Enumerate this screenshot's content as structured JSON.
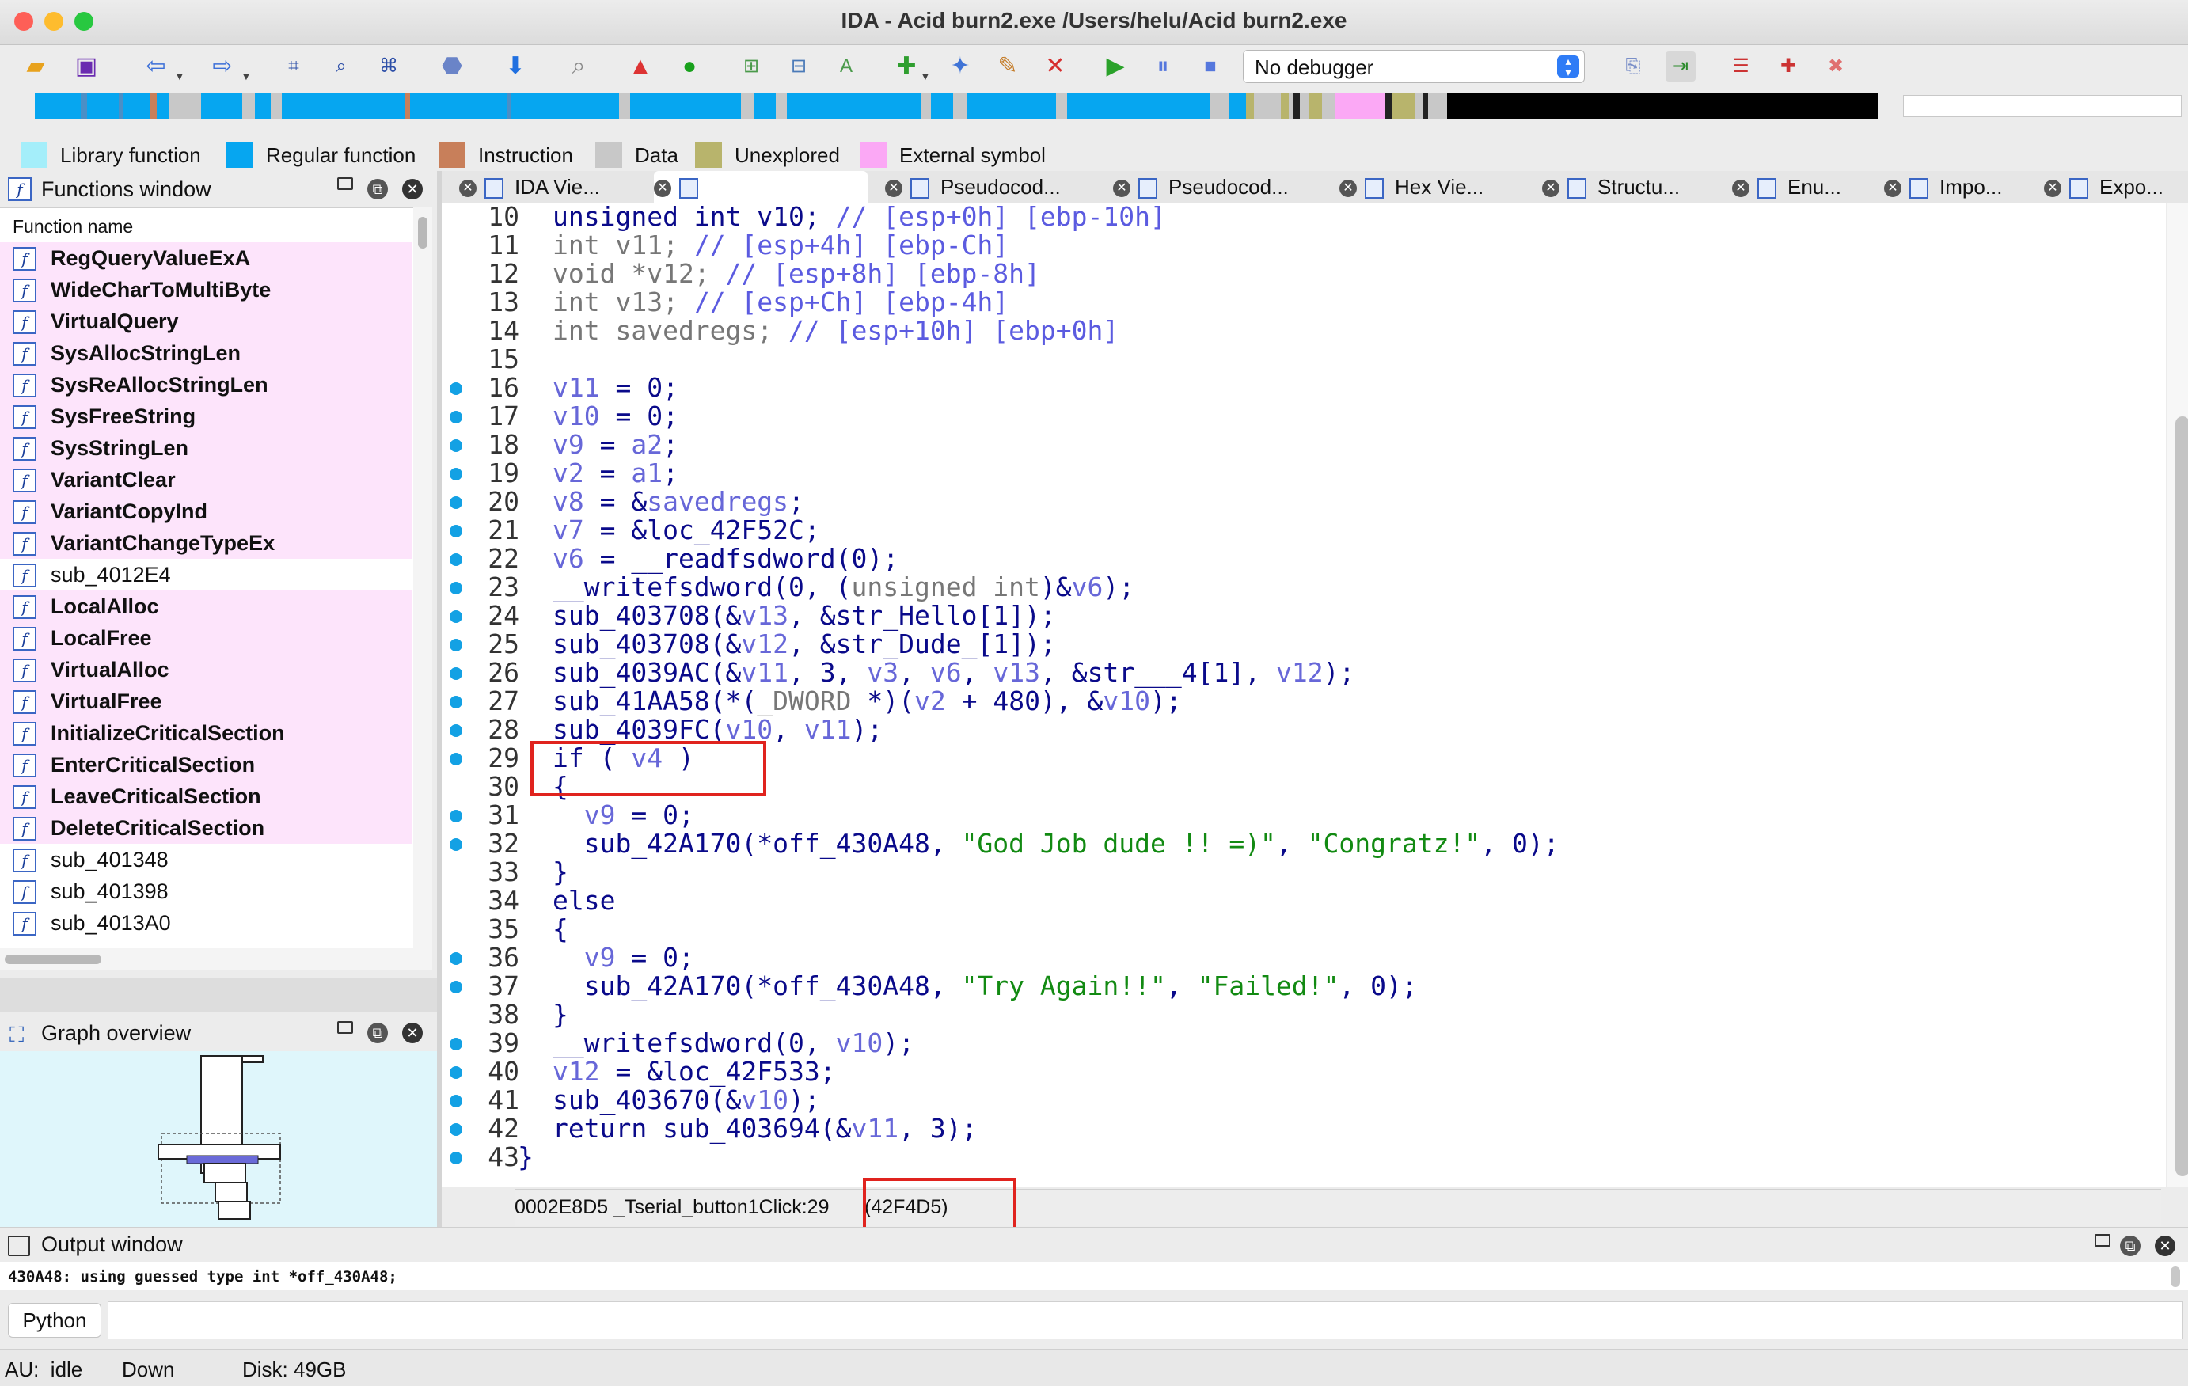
{
  "window": {
    "title": "IDA - Acid burn2.exe /Users/helu/Acid burn2.exe"
  },
  "toolbar": {
    "debugger_select": "No debugger",
    "icons": [
      "open-icon",
      "save-icon",
      "back-icon",
      "forward-icon",
      "jump-icon",
      "search-text-icon",
      "search-binary-icon",
      "hex-icon",
      "down-arrow-icon",
      "search-icon",
      "warning-icon",
      "run-green-icon",
      "code-icon",
      "data-icon",
      "string-icon",
      "add-struct-icon",
      "add-enum-icon",
      "patch-icon",
      "delete-icon",
      "start-debug-icon",
      "pause-icon",
      "stop-icon"
    ]
  },
  "legend": [
    {
      "label": "Library function",
      "color": "#a4eefa"
    },
    {
      "label": "Regular function",
      "color": "#06a6f0"
    },
    {
      "label": "Instruction",
      "color": "#c87f5a"
    },
    {
      "label": "Data",
      "color": "#c8c8c8"
    },
    {
      "label": "Unexplored",
      "color": "#b8b46c"
    },
    {
      "label": "External symbol",
      "color": "#fba8f5"
    }
  ],
  "functions_window": {
    "title": "Functions window",
    "column_header": "Function name",
    "items": [
      {
        "name": "RegQueryValueExA",
        "external": true
      },
      {
        "name": "WideCharToMultiByte",
        "external": true
      },
      {
        "name": "VirtualQuery",
        "external": true
      },
      {
        "name": "SysAllocStringLen",
        "external": true
      },
      {
        "name": "SysReAllocStringLen",
        "external": true
      },
      {
        "name": "SysFreeString",
        "external": true
      },
      {
        "name": "SysStringLen",
        "external": true
      },
      {
        "name": "VariantClear",
        "external": true
      },
      {
        "name": "VariantCopyInd",
        "external": true
      },
      {
        "name": "VariantChangeTypeEx",
        "external": true
      },
      {
        "name": "sub_4012E4",
        "external": false
      },
      {
        "name": "LocalAlloc",
        "external": true
      },
      {
        "name": "LocalFree",
        "external": true
      },
      {
        "name": "VirtualAlloc",
        "external": true
      },
      {
        "name": "VirtualFree",
        "external": true
      },
      {
        "name": "InitializeCriticalSection",
        "external": true
      },
      {
        "name": "EnterCriticalSection",
        "external": true
      },
      {
        "name": "LeaveCriticalSection",
        "external": true
      },
      {
        "name": "DeleteCriticalSection",
        "external": true
      },
      {
        "name": "sub_401348",
        "external": false
      },
      {
        "name": "sub_401398",
        "external": false
      },
      {
        "name": "sub_4013A0",
        "external": false
      }
    ]
  },
  "graph_overview": {
    "title": "Graph overview"
  },
  "tabs": [
    {
      "label": "IDA Vie..."
    },
    {
      "label": ""
    },
    {
      "label": "Pseudocod..."
    },
    {
      "label": "Pseudocod..."
    },
    {
      "label": "Hex Vie..."
    },
    {
      "label": "Structu..."
    },
    {
      "label": "Enu..."
    },
    {
      "label": "Impo..."
    },
    {
      "label": "Expo..."
    }
  ],
  "code_lines": [
    {
      "no": "10",
      "bp": false,
      "html": "unsigned int v10; <span class='c'>// [esp+0h] [ebp-10h]</span>"
    },
    {
      "no": "11",
      "bp": false,
      "html": "<span class='g'>int v11; </span><span class='c'>// [esp+4h] [ebp-Ch]</span>"
    },
    {
      "no": "12",
      "bp": false,
      "html": "<span class='g'>void *v12; </span><span class='c'>// [esp+8h] [ebp-8h]</span>"
    },
    {
      "no": "13",
      "bp": false,
      "html": "<span class='g'>int v13; </span><span class='c'>// [esp+Ch] [ebp-4h]</span>"
    },
    {
      "no": "14",
      "bp": false,
      "html": "<span class='g'>int savedregs; </span><span class='c'>// [esp+10h] [ebp+0h]</span>"
    },
    {
      "no": "15",
      "bp": false,
      "html": ""
    },
    {
      "no": "16",
      "bp": true,
      "html": "<span class='v'>v11</span> = 0;"
    },
    {
      "no": "17",
      "bp": true,
      "html": "<span class='v'>v10</span> = 0;"
    },
    {
      "no": "18",
      "bp": true,
      "html": "<span class='v'>v9</span> = <span class='v'>a2</span>;"
    },
    {
      "no": "19",
      "bp": true,
      "html": "<span class='v'>v2</span> = <span class='v'>a1</span>;"
    },
    {
      "no": "20",
      "bp": true,
      "html": "<span class='v'>v8</span> = &amp;<span class='v'>savedregs</span>;"
    },
    {
      "no": "21",
      "bp": true,
      "html": "<span class='v'>v7</span> = &amp;loc_42F52C;"
    },
    {
      "no": "22",
      "bp": true,
      "html": "<span class='v'>v6</span> = __readfsdword(0);"
    },
    {
      "no": "23",
      "bp": true,
      "html": "__writefsdword(0, (<span class='g'>unsigned int</span>)&amp;<span class='v'>v6</span>);"
    },
    {
      "no": "24",
      "bp": true,
      "html": "sub_403708(&amp;<span class='v'>v13</span>, &amp;str_Hello[1]);"
    },
    {
      "no": "25",
      "bp": true,
      "html": "sub_403708(&amp;<span class='v'>v12</span>, &amp;str_Dude_[1]);"
    },
    {
      "no": "26",
      "bp": true,
      "html": "sub_4039AC(&amp;<span class='v'>v11</span>, 3, <span class='v'>v3</span>, <span class='v'>v6</span>, <span class='v'>v13</span>, &amp;str___4[1], <span class='v'>v12</span>);"
    },
    {
      "no": "27",
      "bp": true,
      "html": "sub_41AA58(*(<span class='g'>_DWORD</span> *)(<span class='v'>v2</span> + 480), &amp;<span class='v'>v10</span>);"
    },
    {
      "no": "28",
      "bp": true,
      "html": "sub_4039FC(<span class='v'>v10</span>, <span class='v'>v11</span>);"
    },
    {
      "no": "29",
      "bp": true,
      "html": "if ( <span class='v'>v4</span> )"
    },
    {
      "no": "30",
      "bp": false,
      "html": "{"
    },
    {
      "no": "31",
      "bp": true,
      "html": "  <span class='v'>v9</span> = 0;"
    },
    {
      "no": "32",
      "bp": true,
      "html": "  sub_42A170(*off_430A48, <span class='s'>\"God Job dude !! =)\"</span>, <span class='s'>\"Congratz!\"</span>, 0);"
    },
    {
      "no": "33",
      "bp": false,
      "html": "}"
    },
    {
      "no": "34",
      "bp": false,
      "html": "else"
    },
    {
      "no": "35",
      "bp": false,
      "html": "{"
    },
    {
      "no": "36",
      "bp": true,
      "html": "  <span class='v'>v9</span> = 0;"
    },
    {
      "no": "37",
      "bp": true,
      "html": "  sub_42A170(*off_430A48, <span class='s'>\"Try Again!!\"</span>, <span class='s'>\"Failed!\"</span>, 0);"
    },
    {
      "no": "38",
      "bp": false,
      "html": "}"
    },
    {
      "no": "39",
      "bp": true,
      "html": "__writefsdword(0, <span class='v'>v10</span>);"
    },
    {
      "no": "40",
      "bp": true,
      "html": "<span class='v'>v12</span> = &amp;loc_42F533;"
    },
    {
      "no": "41",
      "bp": true,
      "html": "sub_403670(&amp;<span class='v'>v10</span>);"
    },
    {
      "no": "42",
      "bp": true,
      "html": "return sub_403694(&amp;<span class='v'>v11</span>, 3);"
    },
    {
      "no": "43",
      "bp": true,
      "html": "}"
    }
  ],
  "code_status": {
    "location": "0002E8D5  _Tserial_button1Click:29",
    "address": "(42F4D5)"
  },
  "output_window": {
    "title": "Output window",
    "text": "430A48: using guessed type int *off_430A48;",
    "python_label": "Python"
  },
  "statusbar": {
    "au": "AU:  idle",
    "direction": "Down",
    "disk": "Disk: 49GB"
  }
}
